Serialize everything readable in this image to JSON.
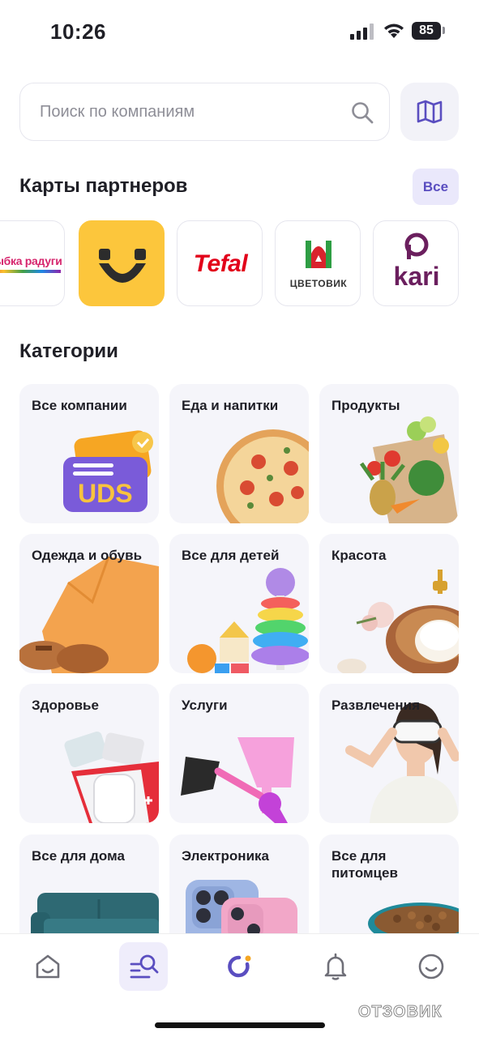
{
  "status_bar": {
    "time": "10:26",
    "battery": "85"
  },
  "search": {
    "placeholder": "Поиск по компаниям"
  },
  "partners": {
    "title": "Карты партнеров",
    "all_label": "Все",
    "items": [
      {
        "name": "ыбка радуги"
      },
      {
        "name": "UDS"
      },
      {
        "name": "Tefal"
      },
      {
        "name": "ЦВЕТОВИК"
      },
      {
        "name": "kari"
      }
    ]
  },
  "categories": {
    "title": "Категории",
    "items": [
      {
        "label": "Все компании"
      },
      {
        "label": "Еда и напитки"
      },
      {
        "label": "Продукты"
      },
      {
        "label": "Одежда и обувь"
      },
      {
        "label": "Все для детей"
      },
      {
        "label": "Красота"
      },
      {
        "label": "Здоровье"
      },
      {
        "label": "Услуги"
      },
      {
        "label": "Развлечения"
      },
      {
        "label": "Все для дома"
      },
      {
        "label": "Электроника"
      },
      {
        "label": "Все для питомцев"
      }
    ]
  },
  "uds_badge": "UDS",
  "bottom_nav": {
    "items": [
      {
        "icon": "home-icon"
      },
      {
        "icon": "search-list-icon",
        "active": true
      },
      {
        "icon": "uds-logo-icon"
      },
      {
        "icon": "bell-icon"
      },
      {
        "icon": "profile-smile-icon"
      }
    ]
  },
  "watermark": "ОТЗОВИК",
  "colors": {
    "accent": "#5a4ec0",
    "accent_bg": "#eae8fb",
    "card_bg": "#f5f5fa",
    "uds_yellow": "#fcc63c"
  }
}
